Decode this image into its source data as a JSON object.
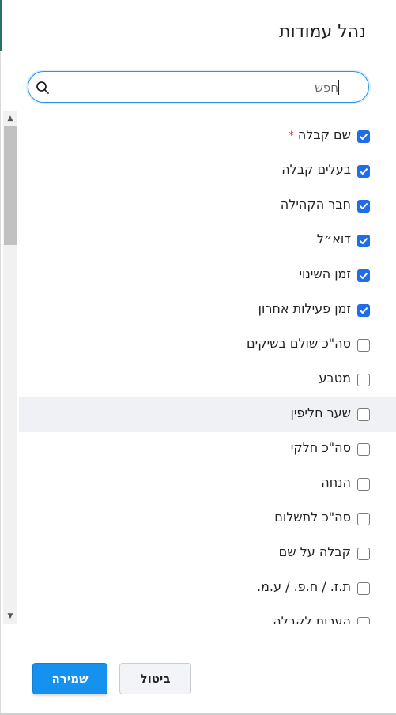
{
  "dialog": {
    "title": "נהל עמודות"
  },
  "search": {
    "placeholder": "חפש",
    "icon": "search-icon"
  },
  "columns": [
    {
      "label": "שם קבלה",
      "checked": true,
      "required": true,
      "required_mark": "*"
    },
    {
      "label": "בעלים קבלה",
      "checked": true
    },
    {
      "label": "חבר הקהילה",
      "checked": true
    },
    {
      "label": "דוא״ל",
      "checked": true
    },
    {
      "label": "זמן השינוי",
      "checked": true
    },
    {
      "label": "זמן פעילות אחרון",
      "checked": true
    },
    {
      "label": "סה\"כ שולם בשיקים",
      "checked": false
    },
    {
      "label": "מטבע",
      "checked": false
    },
    {
      "label": "שער חליפין",
      "checked": false,
      "hovered": true
    },
    {
      "label": "סה\"כ חלקי",
      "checked": false
    },
    {
      "label": "הנחה",
      "checked": false
    },
    {
      "label": "סה\"כ לתשלום",
      "checked": false
    },
    {
      "label": "קבלה על שם",
      "checked": false
    },
    {
      "label": "ת.ז. / ח.פ. / ע.מ.",
      "checked": false
    },
    {
      "label": "הערות לקבלה",
      "checked": false
    }
  ],
  "footer": {
    "save_label": "שמירה",
    "cancel_label": "ביטול"
  },
  "colors": {
    "accent": "#1591ef",
    "checkbox_on": "#1f6ee8",
    "required": "#e53935"
  }
}
